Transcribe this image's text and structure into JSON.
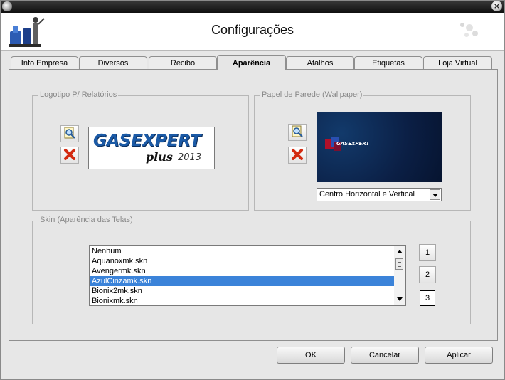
{
  "window": {
    "title": "Configurações"
  },
  "tabs": [
    {
      "label": "Info Empresa",
      "active": false
    },
    {
      "label": "Diversos",
      "active": false
    },
    {
      "label": "Recibo",
      "active": false
    },
    {
      "label": "Aparência",
      "active": true
    },
    {
      "label": "Atalhos",
      "active": false
    },
    {
      "label": "Etiquetas",
      "active": false
    },
    {
      "label": "Loja Virtual",
      "active": false
    }
  ],
  "logo_group": {
    "label": "Logotipo P/ Relatórios",
    "logo_text_main": "GASEXPERT",
    "logo_text_sub": "plus",
    "logo_text_year": "2013"
  },
  "wallpaper_group": {
    "label": "Papel de Parede (Wallpaper)",
    "mini_logo": "GASEXPERT",
    "position_select": "Centro Horizontal e Vertical"
  },
  "skin_group": {
    "label": "Skin (Aparência das Telas)",
    "items": [
      "Nenhum",
      "Aquanoxmk.skn",
      "Avengermk.skn",
      "AzulCinzamk.skn",
      "Bionix2mk.skn",
      "Bionixmk.skn"
    ],
    "selected_index": 3,
    "page_buttons": [
      "1",
      "2",
      "3"
    ],
    "active_page": "3"
  },
  "footer": {
    "ok_label": "OK",
    "cancel_label": "Cancelar",
    "apply_label": "Aplicar"
  },
  "colors": {
    "selection": "#3b83d9",
    "logo_blue": "#1b5aa6",
    "wallpaper_bg": "#0b1f45",
    "delete_red": "#d32a10"
  },
  "icons": {
    "browse": "search-file-icon",
    "delete": "delete-x-icon"
  }
}
